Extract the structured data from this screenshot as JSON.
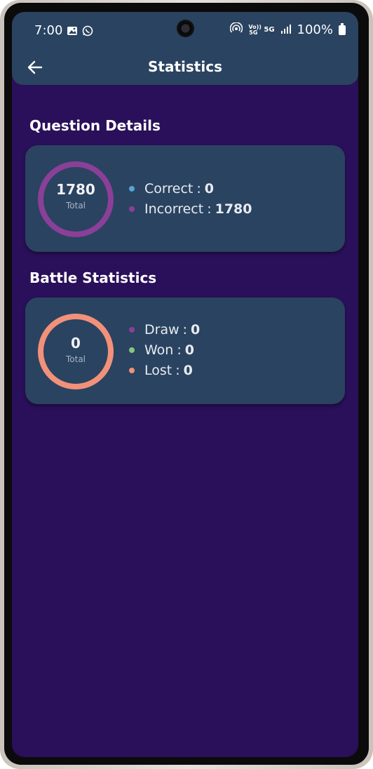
{
  "status_bar": {
    "time": "7:00",
    "left_icons": [
      "image-icon",
      "whatsapp-icon"
    ],
    "right_icons": [
      "hotspot-icon",
      "volte-icon",
      "5g-icon",
      "signal-icon",
      "battery-icon"
    ],
    "volte_label": "Vo)) 5G",
    "net_label": "5G",
    "battery": "100%"
  },
  "app_bar": {
    "title": "Statistics",
    "back_icon": "arrow-left-icon"
  },
  "question_details": {
    "title": "Question Details",
    "total_value": "1780",
    "total_label": "Total",
    "ring_color": "#8a3f98",
    "items": [
      {
        "label": "Correct",
        "value": "0",
        "color": "#5aa3d4"
      },
      {
        "label": "Incorrect",
        "value": "1780",
        "color": "#8a3f98"
      }
    ]
  },
  "battle_statistics": {
    "title": "Battle Statistics",
    "total_value": "0",
    "total_label": "Total",
    "ring_color": "#f2917a",
    "items": [
      {
        "label": "Draw",
        "value": "0",
        "color": "#8a3f98"
      },
      {
        "label": "Won",
        "value": "0",
        "color": "#83c77e"
      },
      {
        "label": "Lost",
        "value": "0",
        "color": "#f2917a"
      }
    ]
  },
  "colors": {
    "background": "#2a0f5a",
    "card": "#2a4360",
    "appbar": "#2a4360"
  }
}
